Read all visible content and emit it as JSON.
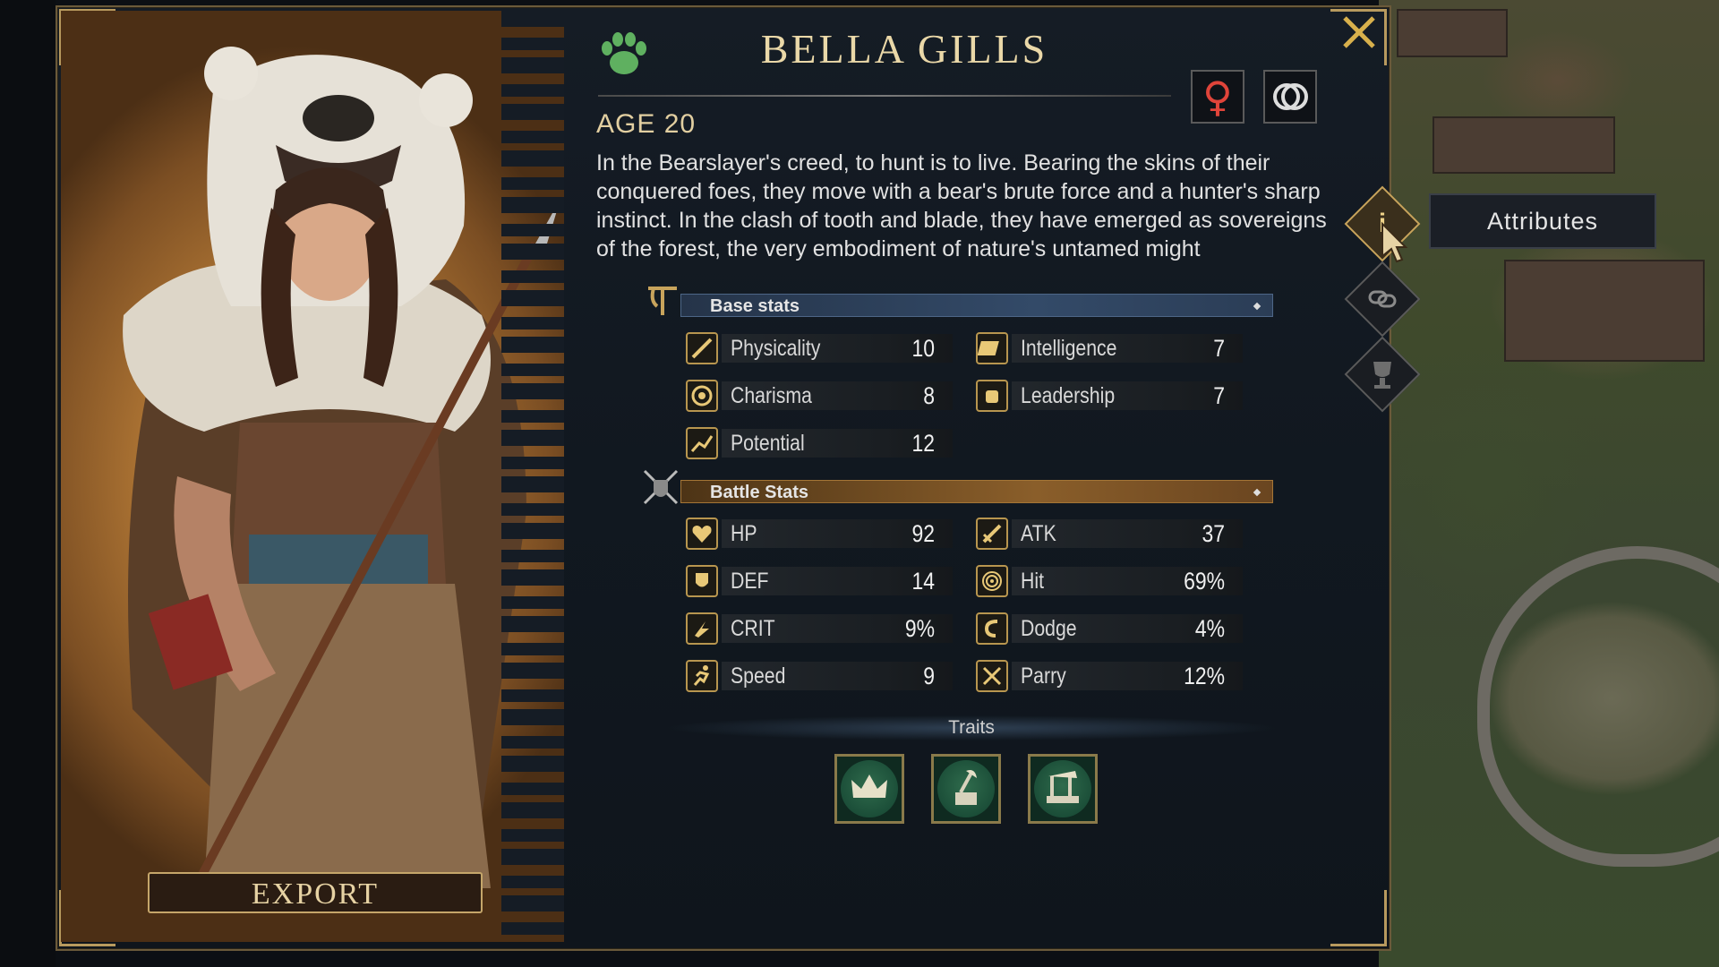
{
  "character": {
    "name": "BELLA GILLS",
    "age_label": "AGE 20",
    "bio": "In the Bearslayer's creed, to hunt is to live. Bearing the skins of their conquered foes, they move with a bear's brute force and a hunter's sharp instinct. In the clash of tooth and blade, they have emerged as sovereigns of the forest, the very embodiment of nature's untamed might",
    "gender_symbol": "♀",
    "class_icon": "paw-icon"
  },
  "export_label": "EXPORT",
  "sections": {
    "base_title": "Base stats",
    "battle_title": "Battle Stats",
    "traits_title": "Traits"
  },
  "base_stats": [
    {
      "label": "Physicality",
      "value": "10",
      "icon": "sword-icon"
    },
    {
      "label": "Intelligence",
      "value": "7",
      "icon": "book-icon"
    },
    {
      "label": "Charisma",
      "value": "8",
      "icon": "heart-badge-icon"
    },
    {
      "label": "Leadership",
      "value": "7",
      "icon": "fist-icon"
    },
    {
      "label": "Potential",
      "value": "12",
      "icon": "trend-up-icon"
    }
  ],
  "battle_stats": [
    {
      "label": "HP",
      "value": "92",
      "icon": "heart-icon"
    },
    {
      "label": "ATK",
      "value": "37",
      "icon": "blade-icon"
    },
    {
      "label": "DEF",
      "value": "14",
      "icon": "shield-arm-icon"
    },
    {
      "label": "Hit",
      "value": "69%",
      "icon": "target-icon"
    },
    {
      "label": "CRIT",
      "value": "9%",
      "icon": "crit-icon"
    },
    {
      "label": "Dodge",
      "value": "4%",
      "icon": "dodge-icon"
    },
    {
      "label": "Speed",
      "value": "9",
      "icon": "run-icon"
    },
    {
      "label": "Parry",
      "value": "12%",
      "icon": "crossed-swords-icon"
    }
  ],
  "traits": [
    {
      "icon": "crown-icon"
    },
    {
      "icon": "axe-stump-icon"
    },
    {
      "icon": "hammer-anvil-icon"
    }
  ],
  "side_tabs": [
    {
      "icon": "info-icon",
      "active": true
    },
    {
      "icon": "link-icon",
      "active": false
    },
    {
      "icon": "trophy-icon",
      "active": false
    }
  ],
  "tooltip_label": "Attributes",
  "colors": {
    "accent_gold": "#c8a45c",
    "base_bar": "#334a68",
    "battle_bar": "#8a5e2a",
    "gender": "#e0443a",
    "paw": "#5fb060"
  }
}
